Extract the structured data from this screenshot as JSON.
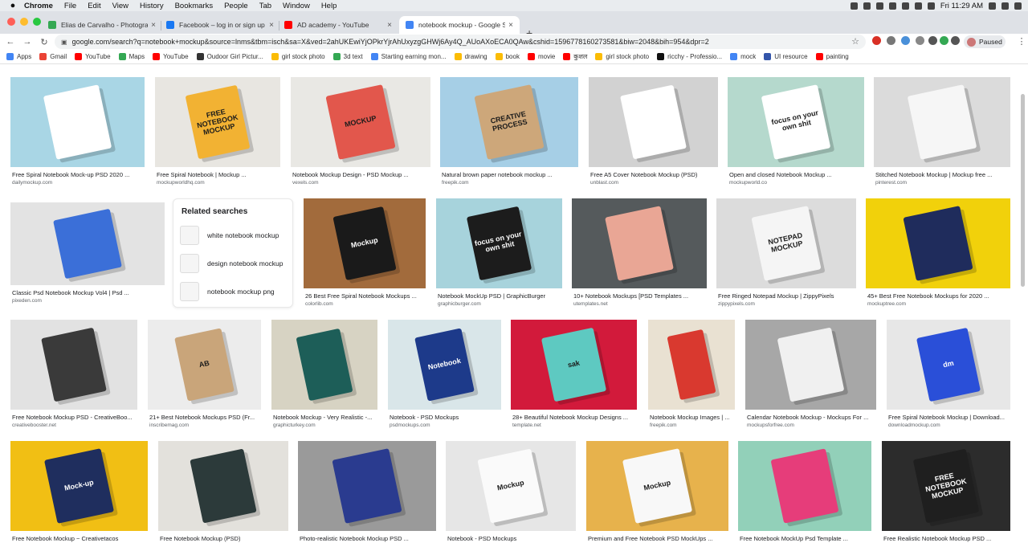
{
  "menubar": {
    "apple": "",
    "items": [
      "Chrome",
      "File",
      "Edit",
      "View",
      "History",
      "Bookmarks",
      "People",
      "Tab",
      "Window",
      "Help"
    ],
    "clock": "Fri 11:29 AM"
  },
  "tabs": [
    {
      "title": "Elias de Carvalho - Photograph",
      "color": "#35a853"
    },
    {
      "title": "Facebook – log in or sign up",
      "color": "#1877f2"
    },
    {
      "title": "AD academy - YouTube",
      "color": "#ff0000"
    },
    {
      "title": "notebook mockup - Google Se",
      "color": "#4285f4"
    }
  ],
  "toolbar": {
    "url": "google.com/search?q=notebook+mockup&source=lnms&tbm=isch&sa=X&ved=2ahUKEwiYjOPkrYjrAhUxyzgGHWj6Ay4Q_AUoAXoECA0QAw&cshid=1596778160273581&biw=2048&bih=954&dpr=2",
    "paused_label": "Paused"
  },
  "bookmarks": [
    {
      "label": "Apps",
      "color": "#4285f4"
    },
    {
      "label": "Gmail",
      "color": "#ea4335"
    },
    {
      "label": "YouTube",
      "color": "#ff0000"
    },
    {
      "label": "Maps",
      "color": "#34a853"
    },
    {
      "label": "YouTube",
      "color": "#ff0000"
    },
    {
      "label": "Oudoor Girl Pictur...",
      "color": "#333333"
    },
    {
      "label": "girl stock photo",
      "color": "#fbbc05"
    },
    {
      "label": "3d text",
      "color": "#34a853"
    },
    {
      "label": "Starting earning mon...",
      "color": "#4285f4"
    },
    {
      "label": "drawing",
      "color": "#fbbc05"
    },
    {
      "label": "book",
      "color": "#fbbc05"
    },
    {
      "label": "movie",
      "color": "#ff0000"
    },
    {
      "label": "कुशल",
      "color": "#ff0000"
    },
    {
      "label": "girl stock photo",
      "color": "#fbbc05"
    },
    {
      "label": "ricchy - Professio...",
      "color": "#111111"
    },
    {
      "label": "mock",
      "color": "#4285f4"
    },
    {
      "label": "UI resource",
      "color": "#3355aa"
    },
    {
      "label": "painting",
      "color": "#ff0000"
    }
  ],
  "related": {
    "heading": "Related searches",
    "items": [
      "white notebook mockup",
      "design notebook mockup",
      "notebook mockup png"
    ]
  },
  "results": [
    {
      "title": "Free Spiral Notebook Mock-up PSD 2020 ...",
      "source": "dailymockup.com",
      "bg": "#a9d6e5",
      "fg": "#ffffff"
    },
    {
      "title": "Free Spiral Notebook | Mockup ...",
      "source": "mockupworldhq.com",
      "bg": "#e8e6e1",
      "fg": "#f2b233",
      "text": "FREE NOTEBOOK MOCKUP"
    },
    {
      "title": "Notebook Mockup Design - PSD Mockup ...",
      "source": "vexels.com",
      "bg": "#e9e8e4",
      "fg": "#e2574c",
      "text": "MOCKUP"
    },
    {
      "title": "Natural brown paper notebook mockup ...",
      "source": "freepik.com",
      "bg": "#a6cfe6",
      "fg": "#cda77a",
      "text": "CREATIVE PROCESS"
    },
    {
      "title": "Free A5 Cover Notebook Mockup (PSD)",
      "source": "unblast.com",
      "bg": "#d2d2d2",
      "fg": "#ffffff"
    },
    {
      "title": "Open and closed Notebook Mockup ...",
      "source": "mockupworld.co",
      "bg": "#b5d9cd",
      "fg": "#ffffff",
      "text": "focus on your own shit"
    },
    {
      "title": "Stitched Notebook Mockup | Mockup free ...",
      "source": "pinterest.com",
      "bg": "#dbdbdb",
      "fg": "#f6f6f6"
    },
    {
      "title": "Classic Psd Notebook Mockup Vol4 | Psd ...",
      "source": "pixeden.com",
      "bg": "#e3e3e3",
      "fg": "#3b6fd8"
    },
    {
      "title": "26 Best Free Spiral Notebook Mockups ...",
      "source": "colorlib.com",
      "bg": "#a26b3c",
      "fg": "#1a1a1a",
      "text": "Mockup"
    },
    {
      "title": "Notebook MockUp PSD | GraphicBurger",
      "source": "graphicburger.com",
      "bg": "#a7d3dc",
      "fg": "#1c1c1c",
      "text": "focus on your own shit"
    },
    {
      "title": "10+ Notebook Mockups [PSD Templates ...",
      "source": "utemplates.net",
      "bg": "#555a5c",
      "fg": "#e9a695"
    },
    {
      "title": "Free Ringed Notepad Mockup | ZippyPixels",
      "source": "zippypixels.com",
      "bg": "#dcdcdc",
      "fg": "#f5f5f5",
      "text": "NOTEPAD MOCKUP"
    },
    {
      "title": "45+ Best Free Notebook Mockups for 2020 ...",
      "source": "mockuptree.com",
      "bg": "#f1d10b",
      "fg": "#1f2c5c"
    },
    {
      "title": "Free Notebook Mockup PSD - CreativeBoo...",
      "source": "creativebooster.net",
      "bg": "#e2e2e2",
      "fg": "#3a3a3a"
    },
    {
      "title": "21+ Best Notebook Mockups PSD (Fr...",
      "source": "inscribemag.com",
      "bg": "#ececec",
      "fg": "#c9a57a",
      "text": "AB"
    },
    {
      "title": "Notebook Mockup - Very Realistic -...",
      "source": "graphicturkey.com",
      "bg": "#d7d3c3",
      "fg": "#1d5e58"
    },
    {
      "title": "Notebook - PSD Mockups",
      "source": "psdmockups.com",
      "bg": "#d9e6e9",
      "fg": "#1d3a8a",
      "text": "Notebook"
    },
    {
      "title": "28+ Beautiful Notebook Mockup Designs ...",
      "source": "template.net",
      "bg": "#d21a3b",
      "fg": "#5ec9c1",
      "text": "sak"
    },
    {
      "title": "Notebook Mockup Images | ...",
      "source": "freepik.com",
      "bg": "#e9e1d2",
      "fg": "#d9392f"
    },
    {
      "title": "Calendar Notebook Mockup - Mockups For ...",
      "source": "mockupsforfree.com",
      "bg": "#a7a7a7",
      "fg": "#f0f0f0"
    },
    {
      "title": "Free Spiral Notebook Mockup | Download...",
      "source": "downloadmockup.com",
      "bg": "#e7e7e7",
      "fg": "#2a4fd8",
      "text": "dm"
    },
    {
      "title": "Free Notebook Mockup ~ Creativetacos",
      "source": "",
      "bg": "#f1bf14",
      "fg": "#1f2e5e",
      "text": "Mock-up"
    },
    {
      "title": "Free Notebook Mockup (PSD)",
      "source": "",
      "bg": "#e3e1dc",
      "fg": "#2c3a3a"
    },
    {
      "title": "Photo-realistic Notebook Mockup PSD ...",
      "source": "",
      "bg": "#9a9a9a",
      "fg": "#2a3b8f"
    },
    {
      "title": "Notebook - PSD Mockups",
      "source": "",
      "bg": "#e6e6e6",
      "fg": "#fafafa",
      "text": "Mockup"
    },
    {
      "title": "Premium and Free Notebook PSD MockUps ...",
      "source": "",
      "bg": "#e7b24c",
      "fg": "#f8f8f8",
      "text": "Mockup"
    },
    {
      "title": "Free Notebook MockUp Psd Template ...",
      "source": "",
      "bg": "#92d0b9",
      "fg": "#e63d7a"
    },
    {
      "title": "Free Realistic Notebook Mockup PSD ...",
      "source": "",
      "bg": "#2c2c2c",
      "fg": "#1f1f1f",
      "text": "FREE NOTEBOOK MOCKUP"
    }
  ]
}
